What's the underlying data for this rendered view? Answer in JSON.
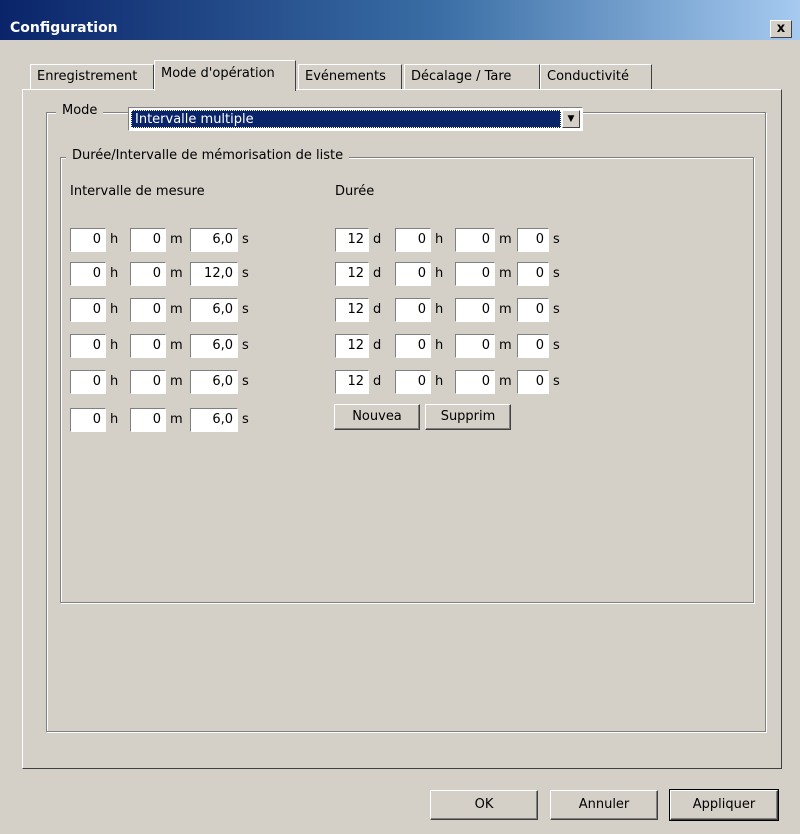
{
  "window": {
    "title": "Configuration",
    "close_label": "x"
  },
  "tabs": [
    {
      "label": "Enregistrement"
    },
    {
      "label": "Mode d'opération"
    },
    {
      "label": "Evénements"
    },
    {
      "label": "Décalage / Tare"
    },
    {
      "label": "Conductivité"
    }
  ],
  "mode": {
    "label": "Mode",
    "selected": "Intervalle multiple"
  },
  "group": {
    "label": "Durée/Intervalle de mémorisation de liste"
  },
  "interval": {
    "heading": "Intervalle de mesure",
    "units": {
      "h": "h",
      "m": "m",
      "s": "s"
    },
    "rows": [
      {
        "h": "0",
        "m": "0",
        "s": "6,0"
      },
      {
        "h": "0",
        "m": "0",
        "s": "12,0"
      },
      {
        "h": "0",
        "m": "0",
        "s": "6,0"
      },
      {
        "h": "0",
        "m": "0",
        "s": "6,0"
      },
      {
        "h": "0",
        "m": "0",
        "s": "6,0"
      },
      {
        "h": "0",
        "m": "0",
        "s": "6,0"
      }
    ]
  },
  "duration": {
    "heading": "Durée",
    "units": {
      "d": "d",
      "h": "h",
      "m": "m",
      "s": "s"
    },
    "rows": [
      {
        "d": "12",
        "h": "0",
        "m": "0",
        "s": "0"
      },
      {
        "d": "12",
        "h": "0",
        "m": "0",
        "s": "0"
      },
      {
        "d": "12",
        "h": "0",
        "m": "0",
        "s": "0"
      },
      {
        "d": "12",
        "h": "0",
        "m": "0",
        "s": "0"
      },
      {
        "d": "12",
        "h": "0",
        "m": "0",
        "s": "0"
      }
    ]
  },
  "actions": {
    "new_label": "Nouvea",
    "delete_label": "Supprim"
  },
  "footer": {
    "ok_label": "OK",
    "cancel_label": "Annuler",
    "apply_label": "Appliquer"
  }
}
